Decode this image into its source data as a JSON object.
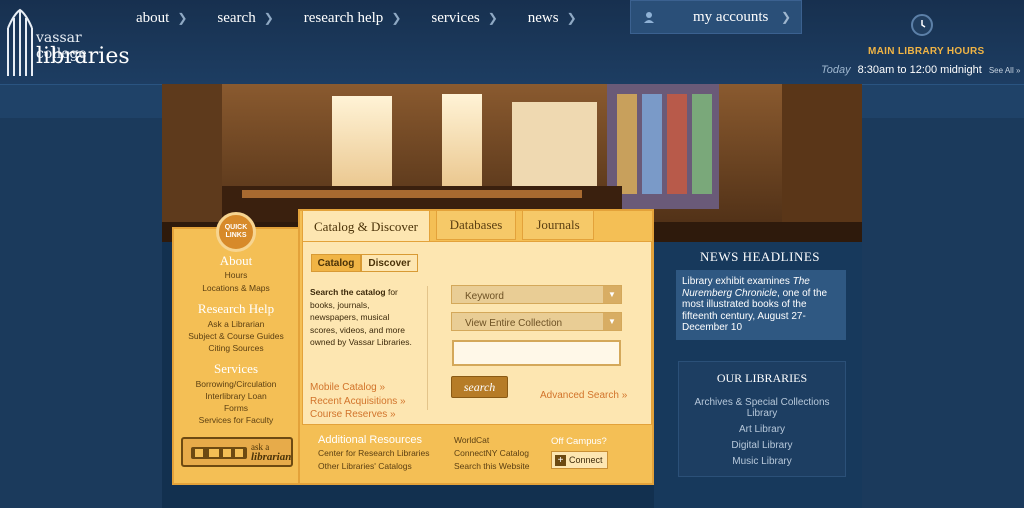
{
  "logo": {
    "line1": "vassar college",
    "line2": "libraries"
  },
  "nav": {
    "items": [
      {
        "label": "about"
      },
      {
        "label": "search"
      },
      {
        "label": "research help"
      },
      {
        "label": "services"
      },
      {
        "label": "news"
      }
    ]
  },
  "accounts": {
    "label": "my accounts"
  },
  "hours": {
    "title": "MAIN LIBRARY HOURS",
    "today": "Today",
    "time": "8:30am to 12:00 midnight",
    "see_all": "See All »"
  },
  "quicklinks": {
    "badge": "QUICK LINKS",
    "sections": [
      {
        "heading": "About",
        "links": [
          "Hours",
          "Locations & Maps"
        ]
      },
      {
        "heading": "Research Help",
        "links": [
          "Ask a Librarian",
          "Subject & Course Guides",
          "Citing Sources"
        ]
      },
      {
        "heading": "Services",
        "links": [
          "Borrowing/Circulation",
          "Interlibrary Loan",
          "Forms",
          "Services for Faculty"
        ]
      }
    ],
    "ask_line1": "ask a",
    "ask_line2": "librarian"
  },
  "tabs": [
    {
      "label": "Catalog & Discover"
    },
    {
      "label": "Databases"
    },
    {
      "label": "Journals"
    }
  ],
  "subtabs": [
    {
      "label": "Catalog"
    },
    {
      "label": "Discover"
    }
  ],
  "catalog": {
    "desc_bold": "Search the catalog",
    "desc_rest": " for books, journals, newspapers, musical scores, videos, and more owned by Vassar Libraries.",
    "keyword": "Keyword",
    "collection": "View Entire Collection",
    "search_btn": "search",
    "advanced": "Advanced Search »",
    "links": [
      "Mobile Catalog »",
      "Recent Acquisitions »",
      "Course Reserves »"
    ]
  },
  "additional": {
    "heading": "Additional Resources",
    "col1": [
      "Center for Research Libraries",
      "Other Libraries' Catalogs"
    ],
    "col2": [
      "WorldCat",
      "ConnectNY Catalog",
      "Search this Website"
    ],
    "off_campus": "Off Campus?",
    "connect": "Connect"
  },
  "news": {
    "heading": "NEWS HEADLINES",
    "pre": "Library exhibit examines ",
    "title": "The Nuremberg Chronicle",
    "post": ", one of the most illustrated books of the fifteenth century, August 27-December 10"
  },
  "libraries": {
    "heading": "OUR LIBRARIES",
    "items": [
      "Archives & Special Collections Library",
      "Art Library",
      "Digital Library",
      "Music Library"
    ]
  }
}
